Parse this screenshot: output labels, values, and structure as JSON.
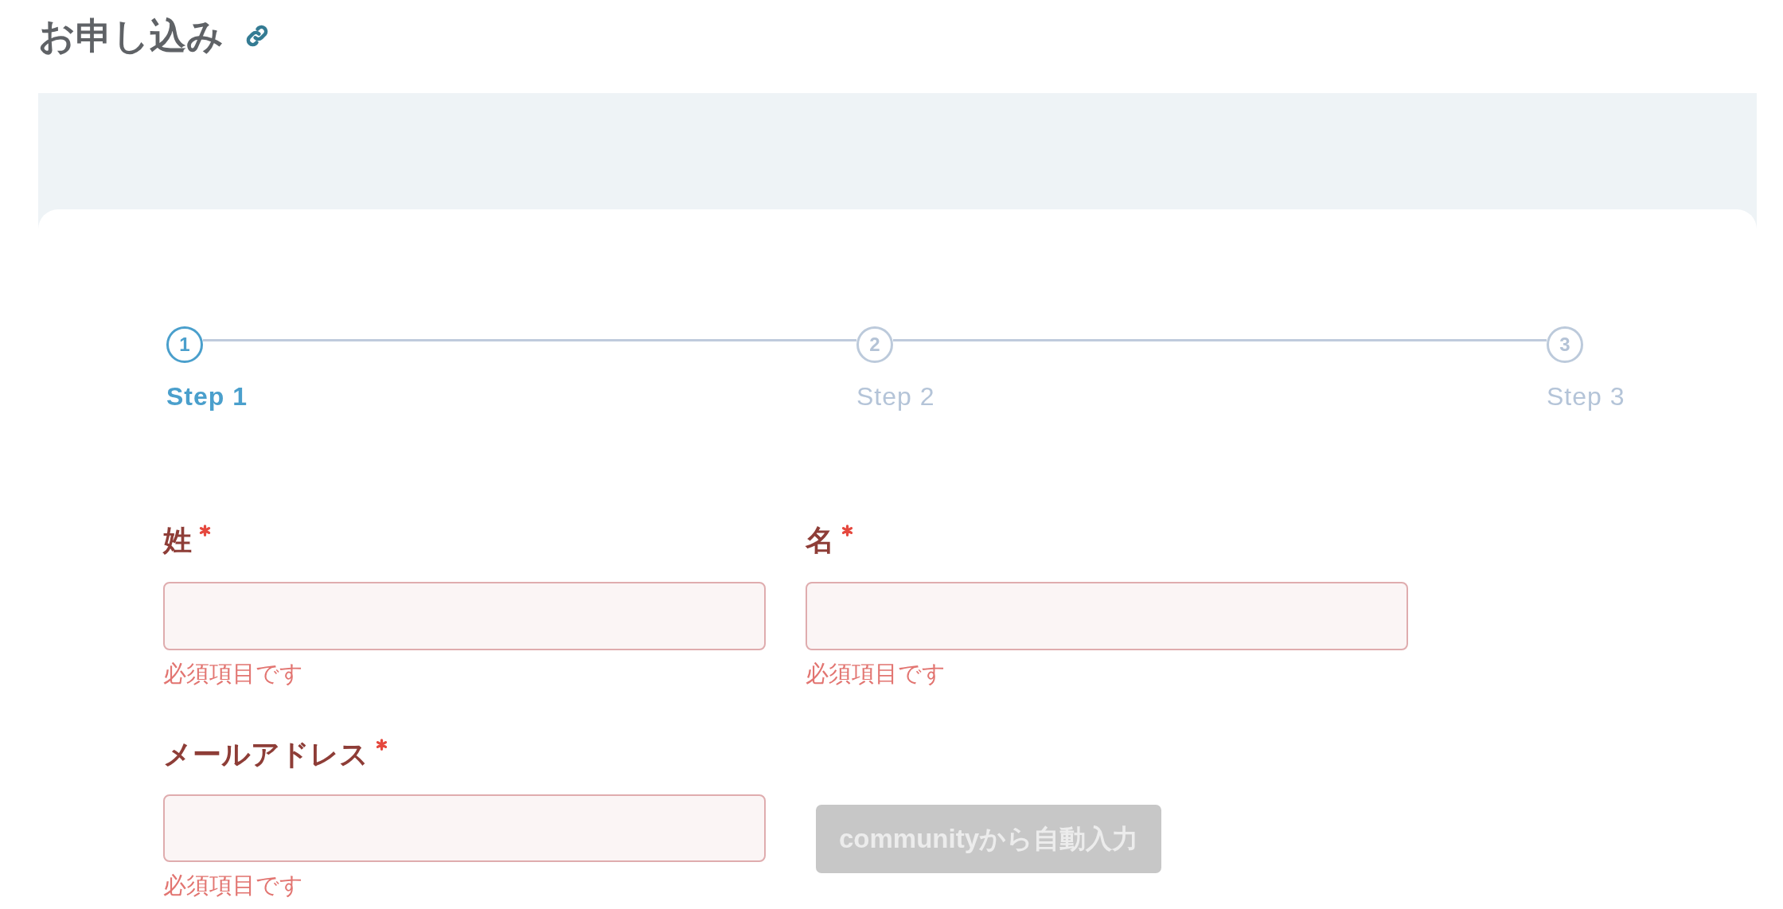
{
  "page": {
    "title": "お申し込み"
  },
  "stepper": {
    "steps": [
      {
        "number": "1",
        "label": "Step 1",
        "current": true
      },
      {
        "number": "2",
        "label": "Step 2",
        "current": false
      },
      {
        "number": "3",
        "label": "Step 3",
        "current": false
      }
    ]
  },
  "form": {
    "name_fields": [
      {
        "label": "姓",
        "required": true,
        "invalid": true,
        "error": "必須項目です"
      },
      {
        "label": "名",
        "required": true,
        "invalid": true,
        "error": "必須項目です"
      }
    ],
    "email_field": {
      "label": "メールアドレス",
      "required": true,
      "invalid": true,
      "error": "必須項目です"
    },
    "autofill_button": {
      "label": "communityから自動入力",
      "disabled": true
    }
  }
}
